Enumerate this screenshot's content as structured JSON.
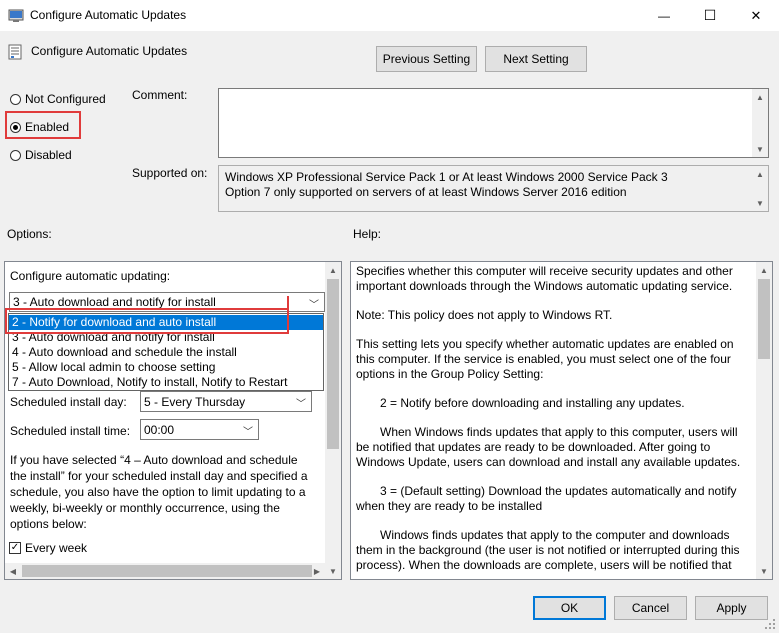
{
  "window": {
    "title": "Configure Automatic Updates",
    "minimize_glyph": "—",
    "maximize_glyph": "☐",
    "close_glyph": "✕"
  },
  "header": {
    "policy_name": "Configure Automatic Updates",
    "prev_label": "Previous Setting",
    "next_label": "Next Setting"
  },
  "state": {
    "not_configured": "Not Configured",
    "enabled": "Enabled",
    "disabled": "Disabled",
    "selected": "Enabled"
  },
  "comment_label": "Comment:",
  "supported_label": "Supported on:",
  "supported_lines": [
    "Windows XP Professional Service Pack 1 or At least Windows 2000 Service Pack 3",
    "Option 7 only supported on servers of at least Windows Server 2016 edition"
  ],
  "options_label": "Options:",
  "help_label": "Help:",
  "options": {
    "configure_label": "Configure automatic updating:",
    "configure_value": "3 - Auto download and notify for install",
    "dropdown_items": [
      "2 - Notify for download and auto install",
      "3 - Auto download and notify for install",
      "4 - Auto download and schedule the install",
      "5 - Allow local admin to choose setting",
      "7 - Auto Download, Notify to install, Notify to Restart"
    ],
    "highlighted_index": 0,
    "install_day_label": "Scheduled install day:",
    "install_day_value": "5 - Every Thursday",
    "install_time_label": "Scheduled install time:",
    "install_time_value": "00:00",
    "info_text": "If you have selected “4 – Auto download and schedule the install” for your scheduled install day and specified a schedule, you also have the option to limit updating to a weekly, bi-weekly or monthly occurrence, using the options below:",
    "every_week_label": "Every week",
    "every_week_checked": true
  },
  "help_paragraphs": [
    "Specifies whether this computer will receive security updates and other important downloads through the Windows automatic updating service.",
    "Note: This policy does not apply to Windows RT.",
    "This setting lets you specify whether automatic updates are enabled on this computer. If the service is enabled, you must select one of the four options in the Group Policy Setting:",
    "2 = Notify before downloading and installing any updates.",
    "When Windows finds updates that apply to this computer, users will be notified that updates are ready to be downloaded. After going to Windows Update, users can download and install any available updates.",
    "3 = (Default setting) Download the updates automatically and notify when they are ready to be installed",
    "Windows finds updates that apply to the computer and downloads them in the background (the user is not notified or interrupted during this process). When the downloads are complete, users will be notified that"
  ],
  "footer": {
    "ok": "OK",
    "cancel": "Cancel",
    "apply": "Apply"
  },
  "colors": {
    "highlight": "#0078d7",
    "annotation_red": "#e03b3b"
  }
}
